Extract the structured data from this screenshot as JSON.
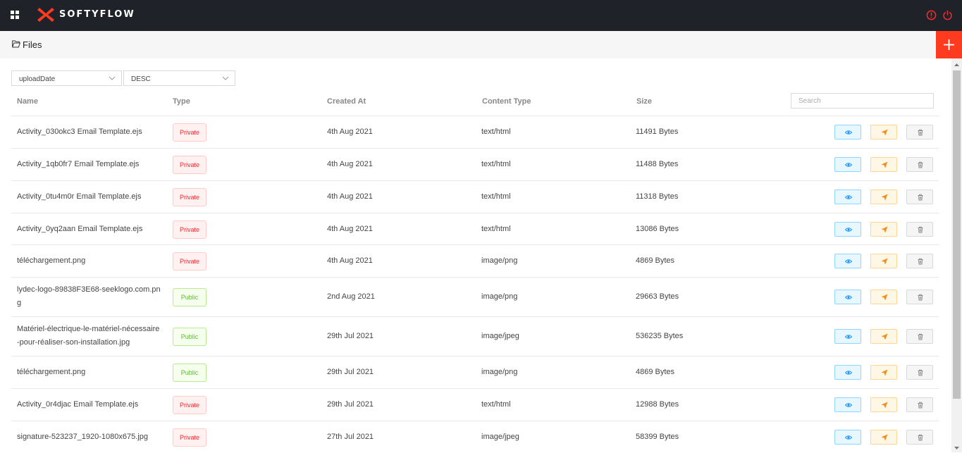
{
  "app": {
    "brand": "SOFTYFLOW"
  },
  "page": {
    "title": "Files"
  },
  "toolbar": {
    "sort_field": "uploadDate",
    "sort_order": "DESC",
    "search_placeholder": "Search"
  },
  "table": {
    "columns": [
      "Name",
      "Type",
      "Created At",
      "Content Type",
      "Size"
    ],
    "rows": [
      {
        "name": "Activity_030okc3 Email Template.ejs",
        "type": "Private",
        "created": "4th Aug 2021",
        "content_type": "text/html",
        "size": "11491 Bytes"
      },
      {
        "name": "Activity_1qb0fr7 Email Template.ejs",
        "type": "Private",
        "created": "4th Aug 2021",
        "content_type": "text/html",
        "size": "11488 Bytes"
      },
      {
        "name": "Activity_0tu4m0r Email Template.ejs",
        "type": "Private",
        "created": "4th Aug 2021",
        "content_type": "text/html",
        "size": "11318 Bytes"
      },
      {
        "name": "Activity_0yq2aan Email Template.ejs",
        "type": "Private",
        "created": "4th Aug 2021",
        "content_type": "text/html",
        "size": "13086 Bytes"
      },
      {
        "name": "téléchargement.png",
        "type": "Private",
        "created": "4th Aug 2021",
        "content_type": "image/png",
        "size": "4869 Bytes"
      },
      {
        "name": "lydec-logo-89838F3E68-seeklogo.com.png",
        "type": "Public",
        "created": "2nd Aug 2021",
        "content_type": "image/png",
        "size": "29663 Bytes"
      },
      {
        "name": "Matériel-électrique-le-matériel-nécessaire-pour-réaliser-son-installation.jpg",
        "type": "Public",
        "created": "29th Jul 2021",
        "content_type": "image/jpeg",
        "size": "536235 Bytes"
      },
      {
        "name": "téléchargement.png",
        "type": "Public",
        "created": "29th Jul 2021",
        "content_type": "image/png",
        "size": "4869 Bytes"
      },
      {
        "name": "Activity_0r4djac Email Template.ejs",
        "type": "Private",
        "created": "29th Jul 2021",
        "content_type": "text/html",
        "size": "12988 Bytes"
      },
      {
        "name": "signature-523237_1920-1080x675.jpg",
        "type": "Private",
        "created": "27th Jul 2021",
        "content_type": "image/jpeg",
        "size": "58399 Bytes"
      }
    ]
  },
  "colors": {
    "topbar": "#1f2329",
    "accent": "#ff3b1f",
    "private": "#f5222d",
    "public": "#52c41a",
    "view": "#1890ff",
    "send": "#fa8c16"
  }
}
